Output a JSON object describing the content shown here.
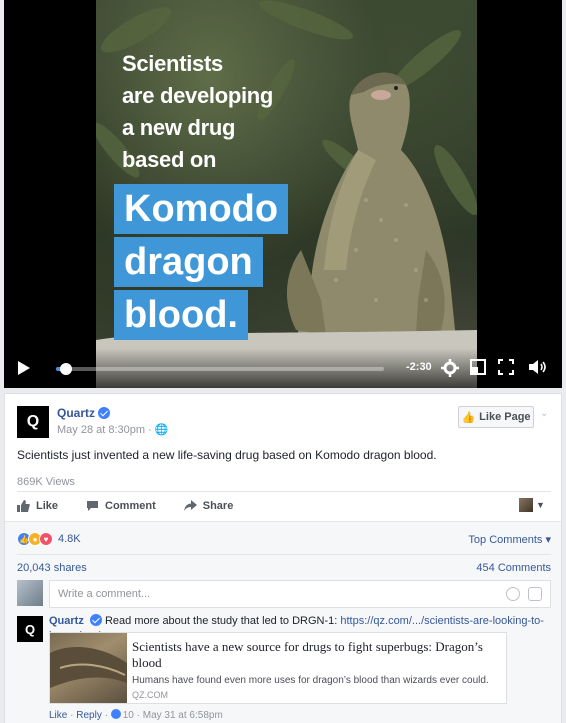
{
  "video": {
    "headline_lines": [
      "Scientists",
      "are developing",
      "a new drug",
      "based on"
    ],
    "highlight_words": [
      "Komodo",
      "dragon",
      "blood."
    ],
    "time_remaining": "-2:30",
    "progress": 0.03,
    "highlight_color": "#3f97d8"
  },
  "post": {
    "page_avatar_letter": "Q",
    "page_name": "Quartz",
    "timestamp": "May 28 at 8:30pm",
    "like_page_label": "Like Page",
    "text": "Scientists just invented a new life-saving drug based on Komodo dragon blood.",
    "views": "869K Views",
    "actions": {
      "like": "Like",
      "comment": "Comment",
      "share": "Share"
    }
  },
  "engagement": {
    "reaction_count": "4.8K",
    "top_comments": "Top Comments",
    "shares": "20,043 shares",
    "comments": "454 Comments",
    "comment_placeholder": "Write a comment..."
  },
  "comment": {
    "avatar_letter": "Q",
    "author": "Quartz",
    "text": "Read more about the study that led to DRGN-1: ",
    "link": "https://qz.com/.../scientists-are-looking-to-komodo.../",
    "card": {
      "title": "Scientists have a new source for drugs to fight superbugs: Dragon’s blood",
      "description": "Humans have found even more uses for dragon’s blood than wizards ever could.",
      "domain": "QZ.COM"
    },
    "like_label": "Like",
    "reply_label": "Reply",
    "like_count": "10",
    "time": "May 31 at 6:58pm"
  },
  "colors": {
    "link_blue": "#365899",
    "brand_blue": "#4080ff",
    "background": "#e9ebee"
  }
}
